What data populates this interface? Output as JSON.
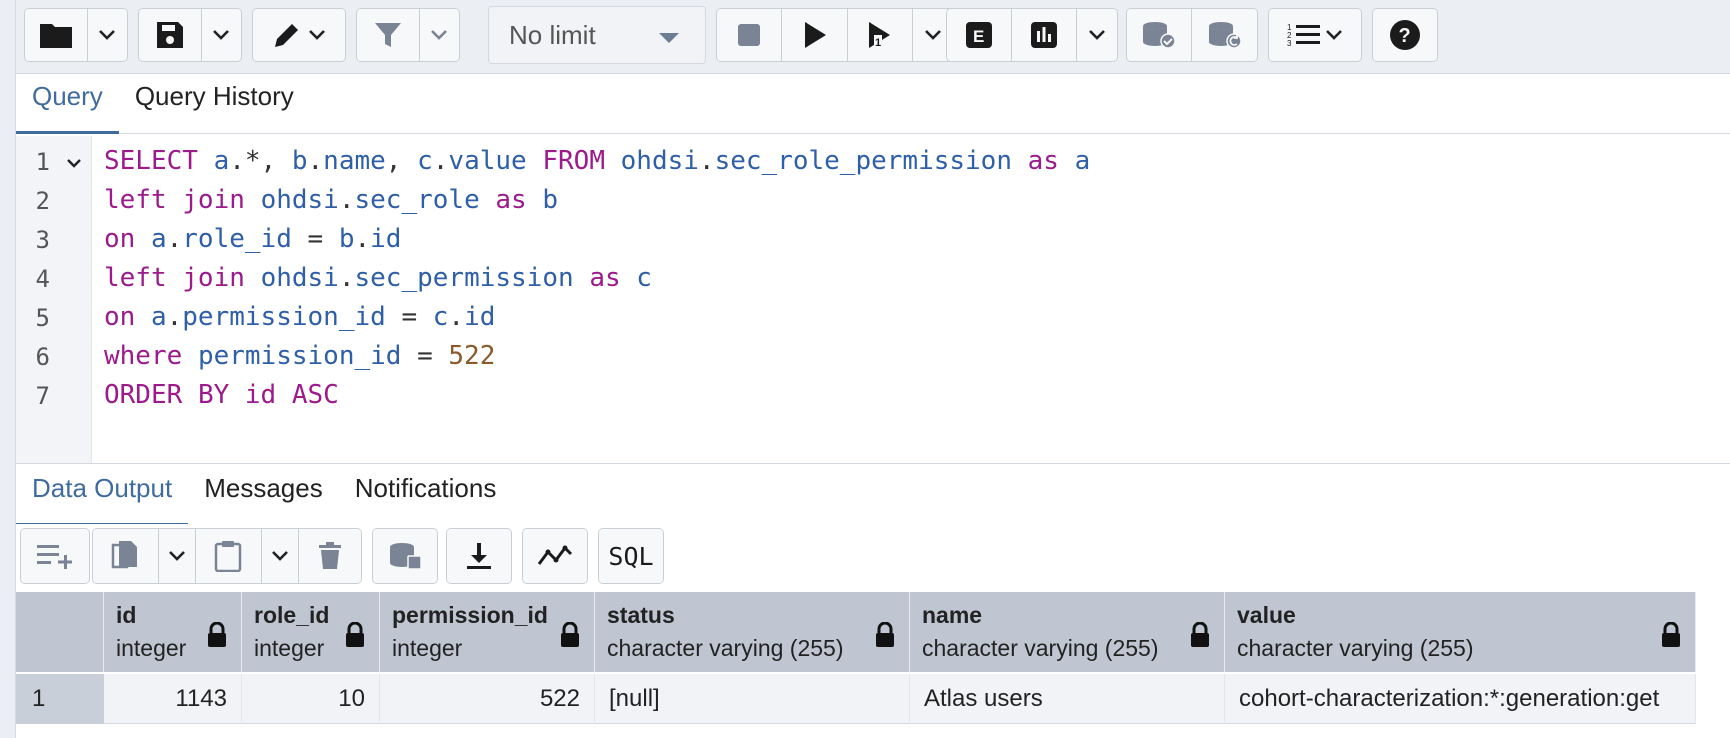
{
  "toolbar": {
    "limit_label": "No limit"
  },
  "editor_tabs": [
    {
      "label": "Query",
      "active": true
    },
    {
      "label": "Query History",
      "active": false
    }
  ],
  "editor": {
    "line_numbers": [
      "1",
      "2",
      "3",
      "4",
      "5",
      "6",
      "7"
    ],
    "sql": [
      "SELECT a.*, b.name, c.value FROM ohdsi.sec_role_permission as a",
      "left join ohdsi.sec_role as b",
      "on a.role_id = b.id",
      "left join ohdsi.sec_permission as c",
      "on a.permission_id = c.id",
      "where permission_id = 522",
      "ORDER BY id ASC"
    ]
  },
  "output_tabs": [
    {
      "label": "Data Output",
      "active": true
    },
    {
      "label": "Messages",
      "active": false
    },
    {
      "label": "Notifications",
      "active": false
    }
  ],
  "output_toolbar": {
    "sql_label": "SQL"
  },
  "grid": {
    "columns": [
      {
        "name": "id",
        "type": "integer"
      },
      {
        "name": "role_id",
        "type": "integer"
      },
      {
        "name": "permission_id",
        "type": "integer"
      },
      {
        "name": "status",
        "type": "character varying (255)"
      },
      {
        "name": "name",
        "type": "character varying (255)"
      },
      {
        "name": "value",
        "type": "character varying (255)"
      }
    ],
    "rows": [
      {
        "rownum": "1",
        "cells": [
          "1143",
          "10",
          "522",
          "[null]",
          "Atlas users",
          "cohort-characterization:*:generation:get"
        ]
      }
    ]
  },
  "colors": {
    "accent": "#3f6b9e",
    "keyword": "#9c1a8c",
    "identifier": "#2f5fa8",
    "number": "#8a5a2b",
    "header_bg": "#bfc6d1"
  }
}
